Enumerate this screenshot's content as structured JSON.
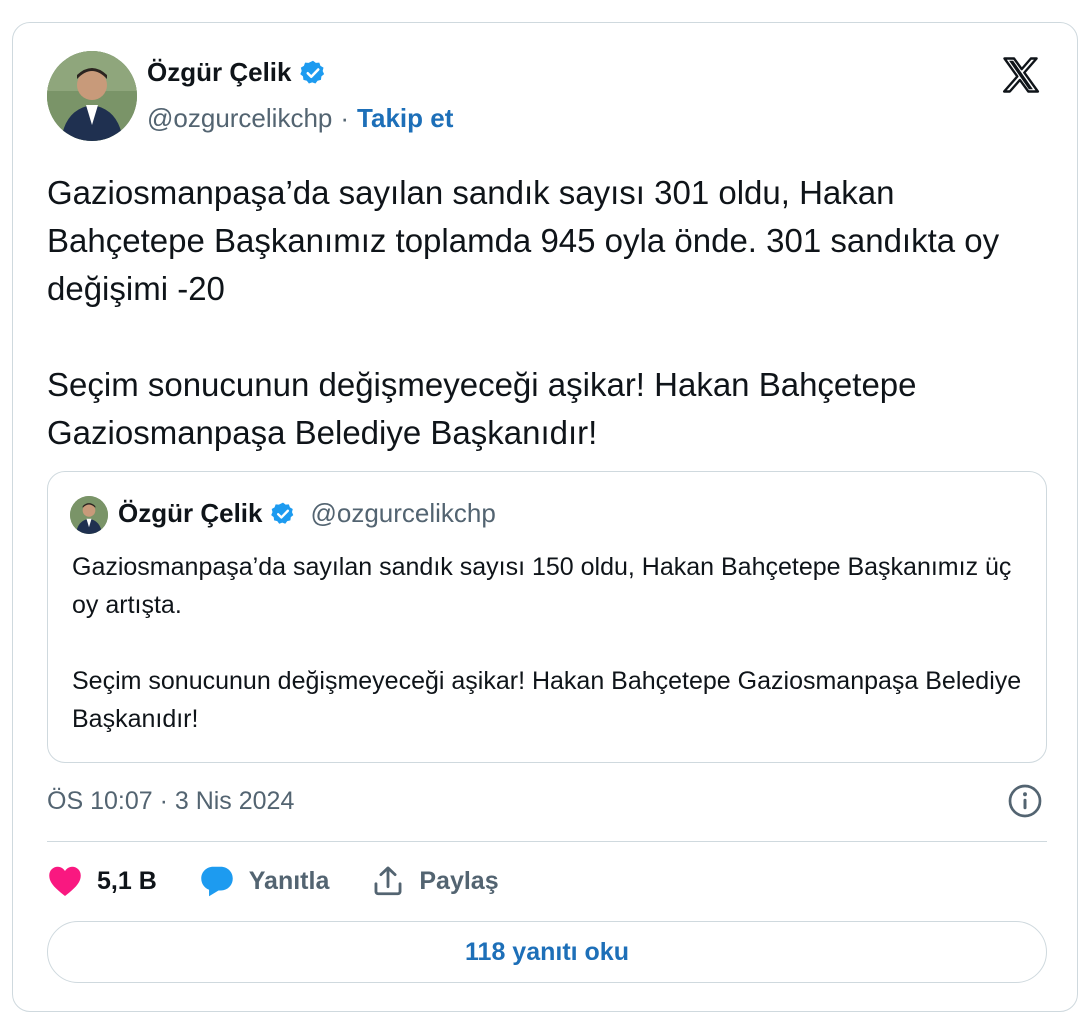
{
  "author": {
    "name": "Özgür Çelik",
    "handle": "@ozgurcelikchp",
    "separator": "·",
    "follow_label": "Takip et",
    "verified_color": "#1d9bf0"
  },
  "tweet": {
    "paragraph1": "Gaziosmanpaşa’da sayılan sandık sayısı 301 oldu, Hakan Bahçetepe Başkanımız toplamda 945 oyla önde. 301 sandıkta oy değişimi -20",
    "paragraph2": "Seçim sonucunun değişmeyeceği aşikar! Hakan Bahçetepe Gaziosmanpaşa Belediye Başkanıdır!"
  },
  "quoted_tweet": {
    "name": "Özgür Çelik",
    "handle": "@ozgurcelikchp",
    "paragraph1": "Gaziosmanpaşa’da sayılan sandık sayısı 150 oldu, Hakan Bahçetepe Başkanımız üç oy artışta.",
    "paragraph2": "Seçim sonucunun değişmeyeceği aşikar! Hakan Bahçetepe Gaziosmanpaşa Belediye Başkanıdır!"
  },
  "timestamp": "ÖS 10:07 · 3 Nis 2024",
  "actions": {
    "like_count": "5,1 B",
    "reply_label": "Yanıtla",
    "share_label": "Paylaş"
  },
  "read_replies_label": "118 yanıtı oku",
  "colors": {
    "like": "#f91880",
    "reply": "#1d9bf0",
    "link": "#1d6fb8",
    "secondary_text": "#536471",
    "border": "#cfd9de"
  },
  "icons": [
    "x-logo-icon",
    "verified-badge-icon",
    "heart-icon",
    "reply-bubble-icon",
    "share-icon",
    "info-icon"
  ]
}
